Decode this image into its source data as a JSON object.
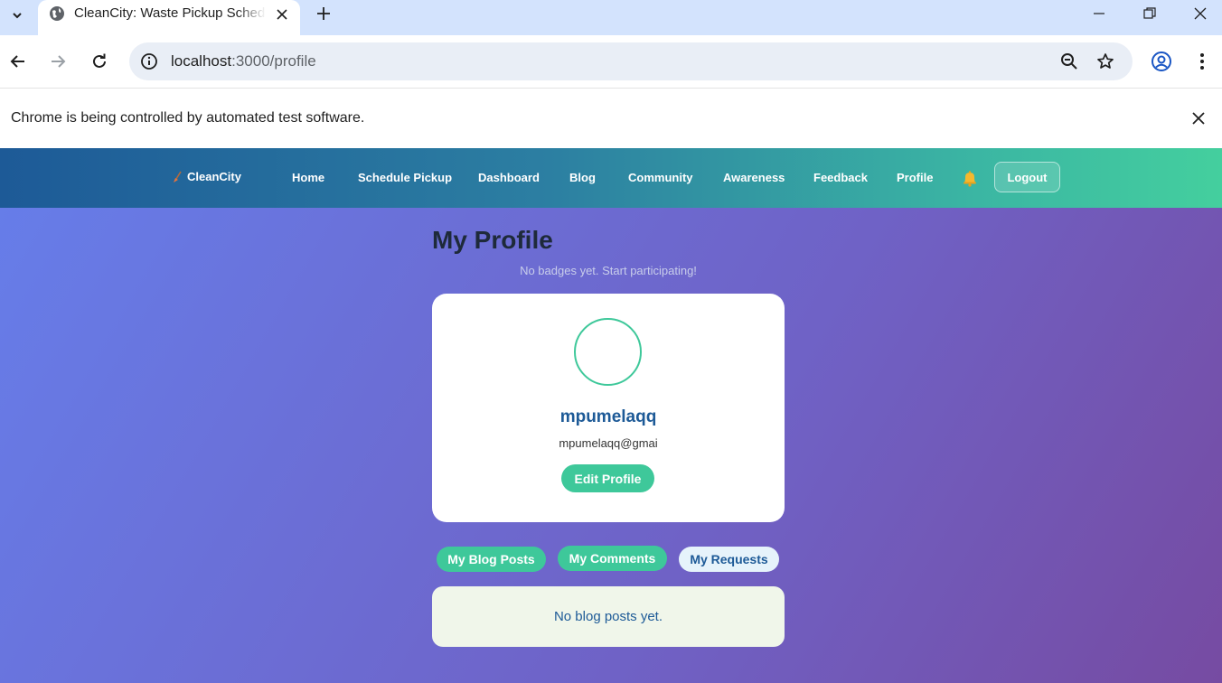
{
  "browser": {
    "tab_title": "CleanCity: Waste Pickup Scheduler",
    "url_host": "localhost",
    "url_path": ":3000/profile",
    "infobar_text": "Chrome is being controlled by automated test software."
  },
  "navbar": {
    "brand": "CleanCity",
    "links": [
      "Home",
      "Schedule Pickup",
      "Dashboard",
      "Blog",
      "Community",
      "Awareness",
      "Feedback",
      "Profile"
    ],
    "logout_label": "Logout"
  },
  "profile": {
    "title": "My Profile",
    "badges_note": "No badges yet. Start participating!",
    "username": "mpumelaqq",
    "email": "mpumelaqq@gmai",
    "edit_label": "Edit Profile"
  },
  "tabs": {
    "blog_posts": "My Blog Posts",
    "comments": "My Comments",
    "requests": "My Requests"
  },
  "content": {
    "empty_message": "No blog posts yet."
  },
  "colors": {
    "accent_green": "#3ec89a",
    "brand_blue": "#1d5a97"
  }
}
